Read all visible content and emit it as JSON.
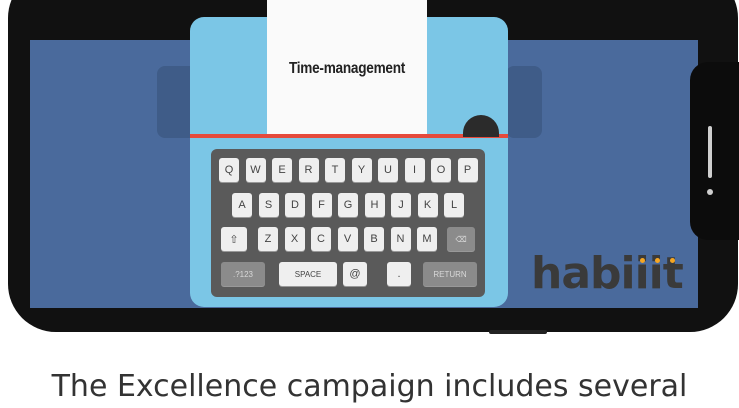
{
  "paper": {
    "text": "Time-management"
  },
  "keyboard": {
    "row1": [
      "Q",
      "W",
      "E",
      "R",
      "T",
      "Y",
      "U",
      "I",
      "O",
      "P"
    ],
    "row2": [
      "A",
      "S",
      "D",
      "F",
      "G",
      "H",
      "J",
      "K",
      "L"
    ],
    "row3": [
      "Z",
      "X",
      "C",
      "V",
      "B",
      "N",
      "M"
    ],
    "row3_extra": {
      "shift": "⇧",
      "delete": "⌫"
    },
    "row4": {
      "num": ".?123",
      "space": "SPACE",
      "at": "@",
      "dot": ".",
      "return": "RETURN"
    }
  },
  "logo": {
    "text": "habiiit",
    "dot_color": "#f5a623"
  },
  "caption": "The Excellence campaign includes several",
  "colors": {
    "screen": "#4a6a9c",
    "typewriter": "#7bc6e6",
    "accent_line": "#e54a3c"
  }
}
